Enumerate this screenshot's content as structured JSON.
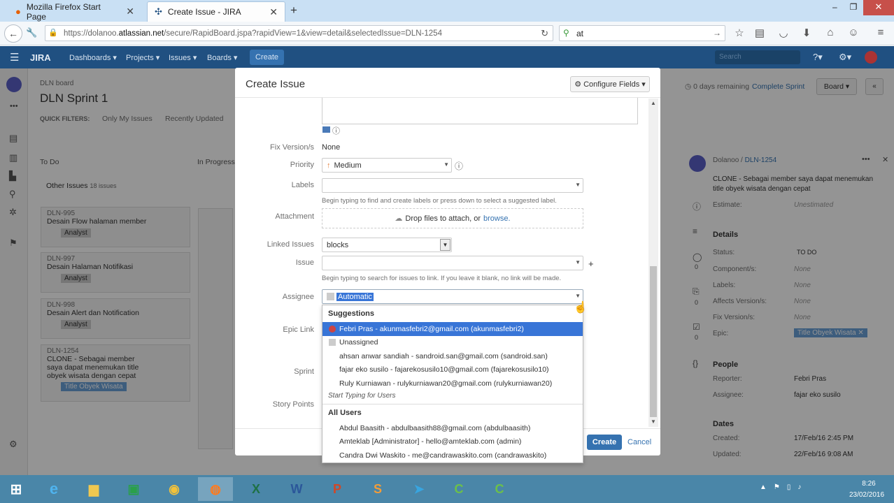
{
  "browser": {
    "tabs": [
      {
        "title": "Mozilla Firefox Start Page"
      },
      {
        "title": "Create Issue - JIRA"
      }
    ],
    "new_tab": "+",
    "url_prefix": "https://dolanoo.",
    "url_domain": "atlassian.net",
    "url_rest": "/secure/RapidBoard.jspa?rapidView=1&view=detail&selectedIssue=DLN-1254",
    "search_value": "at"
  },
  "jira": {
    "logo": "JIRA",
    "nav": [
      "Dashboards ▾",
      "Projects ▾",
      "Issues ▾",
      "Boards ▾"
    ],
    "create": "Create",
    "search_placeholder": "Search"
  },
  "board": {
    "breadcrumb": "DLN board",
    "title": "DLN Sprint 1",
    "quick_filters_label": "QUICK FILTERS:",
    "quick_filters": [
      "Only My Issues",
      "Recently Updated"
    ],
    "days_remaining": "0 days remaining",
    "complete_sprint": "Complete Sprint",
    "board_btn": "Board ▾",
    "col_todo": "To Do",
    "col_progress": "In Progress",
    "swimlane": "Other Issues",
    "swimlane_count": "18 issues",
    "cards": [
      {
        "key": "DLN-995",
        "summary": "Desain Flow halaman member",
        "label": "Analyst"
      },
      {
        "key": "DLN-997",
        "summary": "Desain Halaman Notifikasi",
        "label": "Analyst"
      },
      {
        "key": "DLN-998",
        "summary": "Desain Alert dan Notification",
        "label": "Analyst"
      },
      {
        "key": "DLN-1254",
        "summary": "CLONE - Sebagai member saya dapat menemukan title obyek wisata dengan cepat",
        "label": "Title Obyek Wisata"
      }
    ]
  },
  "dialog": {
    "title": "Create Issue",
    "configure_fields": "Configure Fields ▾",
    "fix_version_label": "Fix Version/s",
    "fix_version_value": "None",
    "priority_label": "Priority",
    "priority_value": "Medium",
    "labels_label": "Labels",
    "labels_hint": "Begin typing to find and create labels or press down to select a suggested label.",
    "attachment_label": "Attachment",
    "attachment_text": "Drop files to attach, or",
    "attachment_link": "browse.",
    "linked_issues_label": "Linked Issues",
    "linked_issues_value": "blocks",
    "issue_label": "Issue",
    "issue_hint": "Begin typing to search for issues to link. If you leave it blank, no link will be made.",
    "assignee_label": "Assignee",
    "assignee_value": "Automatic",
    "epic_link_label": "Epic Link",
    "sprint_label": "Sprint",
    "story_points_label": "Story Points",
    "create_btn": "Create",
    "cancel_btn": "Cancel"
  },
  "dropdown": {
    "suggestions_header": "Suggestions",
    "suggestions": [
      "Febri Pras - akunmasfebri2@gmail.com (akunmasfebri2)",
      "Unassigned",
      "ahsan anwar sandiah - sandroid.san@gmail.com (sandroid.san)",
      "fajar eko susilo - fajarekosusilo10@gmail.com (fajarekosusilo10)",
      "Ruly Kurniawan - rulykurniawan20@gmail.com (rulykurniawan20)"
    ],
    "start_typing": "Start Typing for Users",
    "all_users_header": "All Users",
    "all_users": [
      "Abdul Baasith - abdulbaasith88@gmail.com (abdulbaasith)",
      "Amteklab [Administrator] - hello@amteklab.com (admin)",
      "Candra Dwi Waskito - me@candrawaskito.com (candrawaskito)"
    ]
  },
  "detail": {
    "project": "Dolanoo /",
    "key": "DLN-1254",
    "summary": "CLONE - Sebagai member saya dapat menemukan title obyek wisata dengan cepat",
    "estimate_label": "Estimate:",
    "estimate_value": "Unestimated",
    "details_header": "Details",
    "status_label": "Status:",
    "status_value": "TO DO",
    "components_label": "Component/s:",
    "components_value": "None",
    "labels_label": "Labels:",
    "labels_value": "None",
    "affects_label": "Affects Version/s:",
    "affects_value": "None",
    "fix_label": "Fix Version/s:",
    "fix_value": "None",
    "epic_label": "Epic:",
    "epic_value": "Title Obyek Wisata",
    "people_header": "People",
    "reporter_label": "Reporter:",
    "reporter_value": "Febri Pras",
    "assignee_label": "Assignee:",
    "assignee_value": "fajar eko susilo",
    "dates_header": "Dates",
    "created_label": "Created:",
    "created_value": "17/Feb/16 2:45 PM",
    "updated_label": "Updated:",
    "updated_value": "22/Feb/16 9:08 AM",
    "counts": [
      "0",
      "0",
      "0",
      "0"
    ]
  },
  "taskbar": {
    "time": "8:26",
    "date": "23/02/2016"
  }
}
